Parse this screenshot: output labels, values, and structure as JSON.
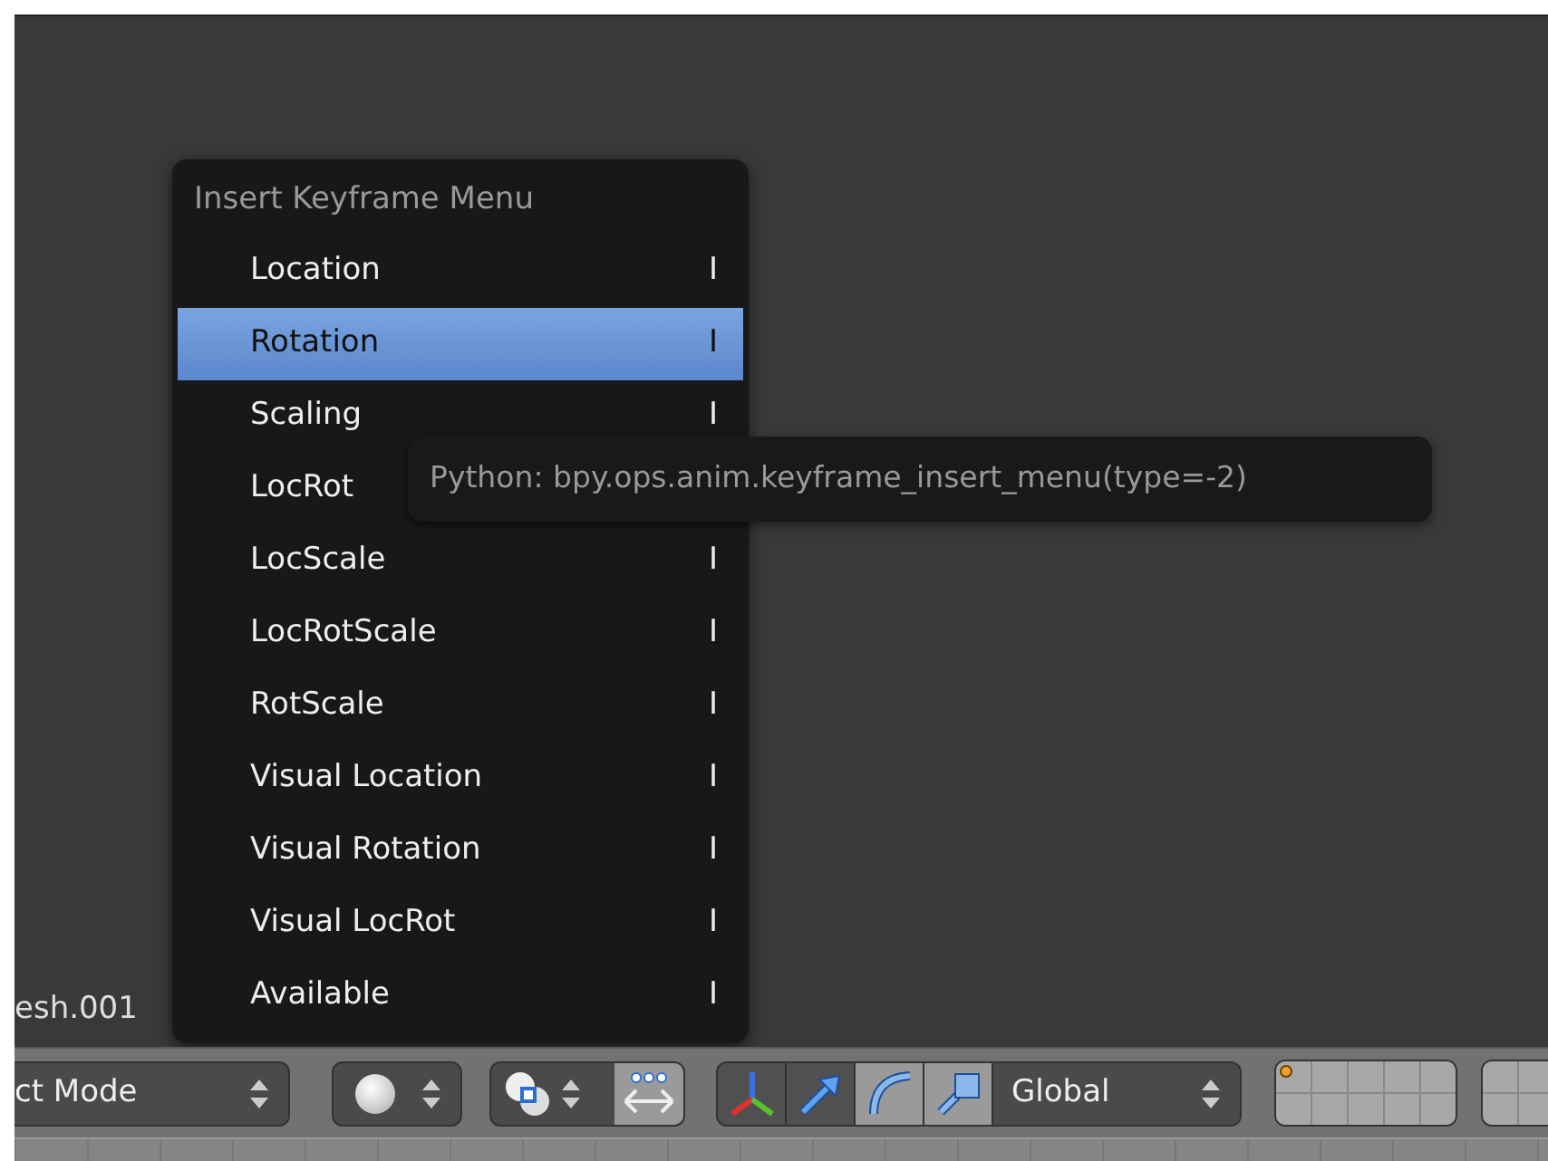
{
  "viewport": {
    "object_name": "esh.001"
  },
  "menu": {
    "title": "Insert Keyframe Menu",
    "items": [
      {
        "label": "Location",
        "shortcut": "I",
        "selected": false
      },
      {
        "label": "Rotation",
        "shortcut": "I",
        "selected": true
      },
      {
        "label": "Scaling",
        "shortcut": "I",
        "selected": false
      },
      {
        "label": "LocRot",
        "selected": false
      },
      {
        "label": "LocScale",
        "shortcut": "I",
        "selected": false
      },
      {
        "label": "LocRotScale",
        "shortcut": "I",
        "selected": false
      },
      {
        "label": "RotScale",
        "shortcut": "I",
        "selected": false
      },
      {
        "label": "Visual Location",
        "shortcut": "I",
        "selected": false
      },
      {
        "label": "Visual Rotation",
        "shortcut": "I",
        "selected": false
      },
      {
        "label": "Visual LocRot",
        "shortcut": "I",
        "selected": false
      },
      {
        "label": "Available",
        "shortcut": "I",
        "selected": false
      }
    ]
  },
  "tooltip": "Python: bpy.ops.anim.keyframe_insert_menu(type=-2)",
  "header": {
    "mode": "ct Mode",
    "orientation": "Global",
    "manipulators": [
      {
        "kind": "axes",
        "selected": true
      },
      {
        "kind": "translate",
        "selected": true
      },
      {
        "kind": "rotate",
        "selected": false
      },
      {
        "kind": "scale",
        "selected": false
      }
    ],
    "align_toggle": {
      "selected": false
    },
    "layers": [
      {
        "used": true
      },
      {
        "used": false
      },
      {
        "used": false
      },
      {
        "used": false
      },
      {
        "used": false
      },
      {
        "used": false
      },
      {
        "used": false
      },
      {
        "used": false
      },
      {
        "used": false
      },
      {
        "used": false
      }
    ]
  }
}
